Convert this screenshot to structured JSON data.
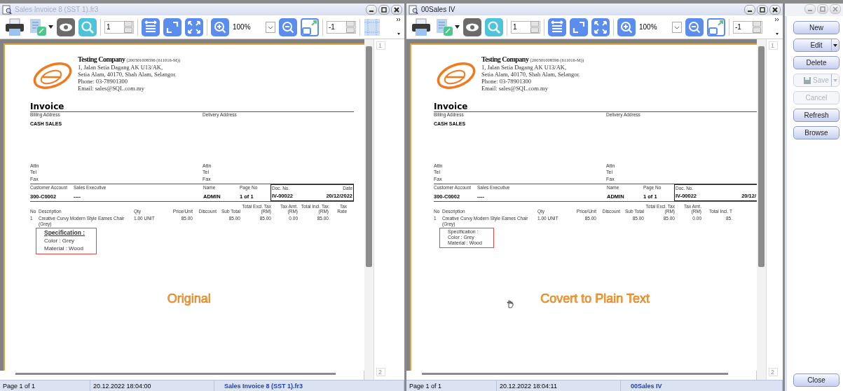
{
  "windows": [
    {
      "title": "Sales Invoice 8 (SST 1).fr3",
      "active": false,
      "page_field": "1",
      "zoom": "100%",
      "offset_field": "-1",
      "show_grid_tool": true,
      "show_hand_cursor": false,
      "document": {
        "company": {
          "name": "Testing Company",
          "reg": "(200301008596 (611016-M))",
          "lines": [
            "1, Jalan Setia Dagang AK U13/AK,",
            "Setia Alam, 40170, Shah Alam, Selangor.",
            "Phone: 03-78901300",
            "Email: sales@SQL.com.my"
          ]
        },
        "title": "Invoice",
        "billing_label": "Billing Address",
        "delivery_label": "Delivery Address",
        "customer": "CASH SALES",
        "billing_contacts": [
          "Attn",
          "Tel",
          "Fax"
        ],
        "delivery_contacts": [
          "Attn",
          "Tel",
          "Fax"
        ],
        "info": [
          {
            "label": "Customer Account",
            "value": "300-C0002"
          },
          {
            "label": "Sales Executive",
            "value": "----"
          },
          {
            "label": "Name",
            "value": "ADMIN"
          },
          {
            "label": "Page No",
            "value": "1 of 1"
          }
        ],
        "doc_box": {
          "label": "Doc. No.",
          "value": "IV-00022",
          "date_label": "Date",
          "date_value": "20/12/2022"
        },
        "columns": [
          "No",
          "Description",
          "Qty",
          "Price/Unit",
          "Discount",
          "Sub Total",
          "Total Excl. Tax (RM)",
          "Tax Amt. (RM)",
          "Total Incl. Tax (RM)",
          "Tax Rate"
        ],
        "rows": [
          {
            "cells": [
              "1",
              "Creative Curvy Modern Style Eames Chair (Grey)",
              "1.00 UNIT",
              "85.00",
              "",
              "85.00",
              "85.00",
              "0.00",
              "85.00",
              ""
            ]
          }
        ],
        "spec": {
          "emphasized": true,
          "heading": "Specification :",
          "lines": [
            "Color : Grey",
            "Material : Wood"
          ]
        }
      },
      "overlay_label": "Original",
      "ruler": [
        "1",
        "2"
      ],
      "status": {
        "page": "Page 1 of 1",
        "time": "20.12.2022 18:04:00",
        "file": "Sales Invoice 8 (SST 1).fr3"
      }
    },
    {
      "title": "00Sales IV",
      "active": true,
      "page_field": "1",
      "zoom": "100%",
      "offset_field": "-1",
      "show_grid_tool": false,
      "show_hand_cursor": true,
      "document": {
        "company": {
          "name": "Testing Company",
          "reg": "(200301008596 (611016-M))",
          "lines": [
            "1, Jalan Setia Dagang AK U13/AK,",
            "Setia Alam, 40170, Shah Alam, Selangor.",
            "Phone: 03-78901300",
            "Email: sales@SQL.com.my"
          ]
        },
        "title": "Invoice",
        "billing_label": "Billing Address",
        "delivery_label": "Delivery Address",
        "customer": "CASH SALES",
        "billing_contacts": [
          "Attn",
          "Tel",
          "Fax"
        ],
        "delivery_contacts": [
          "Attn",
          "Tel",
          "Fax"
        ],
        "info": [
          {
            "label": "Customer Account",
            "value": "300-C0002"
          },
          {
            "label": "Sales Executive",
            "value": "----"
          },
          {
            "label": "Name",
            "value": "ADMIN"
          },
          {
            "label": "Page No",
            "value": "1 of 1"
          }
        ],
        "doc_box": {
          "label": "Doc. No.",
          "value": "IV-00022",
          "date_value": "20/12/"
        },
        "columns": [
          "No",
          "Description",
          "Qty",
          "Price/Unit",
          "Discount",
          "Sub Total",
          "Total Excl. Tax (RM)",
          "Tax Amt. (RM)",
          "Total Incl. T"
        ],
        "rows": [
          {
            "cells": [
              "1",
              "Creative Curvy Modern Style Eames Chair (Grey)",
              "1.00 UNIT",
              "85.00",
              "",
              "85.00",
              "85.00",
              "0.00",
              "85."
            ]
          }
        ],
        "spec": {
          "emphasized": false,
          "heading": "Specification :",
          "lines": [
            "Color : Grey",
            "Material : Wood"
          ]
        }
      },
      "overlay_label": "Covert to Plain Text",
      "ruler": [
        "1",
        "2"
      ],
      "status": {
        "page": "Page 1 of 1",
        "time": "20.12.2022 18:04:11",
        "file": "00Sales IV"
      }
    }
  ],
  "side_panel": {
    "buttons": [
      {
        "label": "New",
        "kind": "plain",
        "disabled": false
      },
      {
        "label": "Edit",
        "kind": "split",
        "disabled": false
      },
      {
        "label": "Delete",
        "kind": "plain",
        "disabled": false
      },
      {
        "label": "Save",
        "kind": "icon_split",
        "disabled": true
      },
      {
        "label": "Cancel",
        "kind": "plain",
        "disabled": true
      },
      {
        "label": "Refresh",
        "kind": "plain",
        "disabled": false
      },
      {
        "label": "Browse",
        "kind": "plain",
        "disabled": false
      }
    ],
    "close": "Close"
  }
}
